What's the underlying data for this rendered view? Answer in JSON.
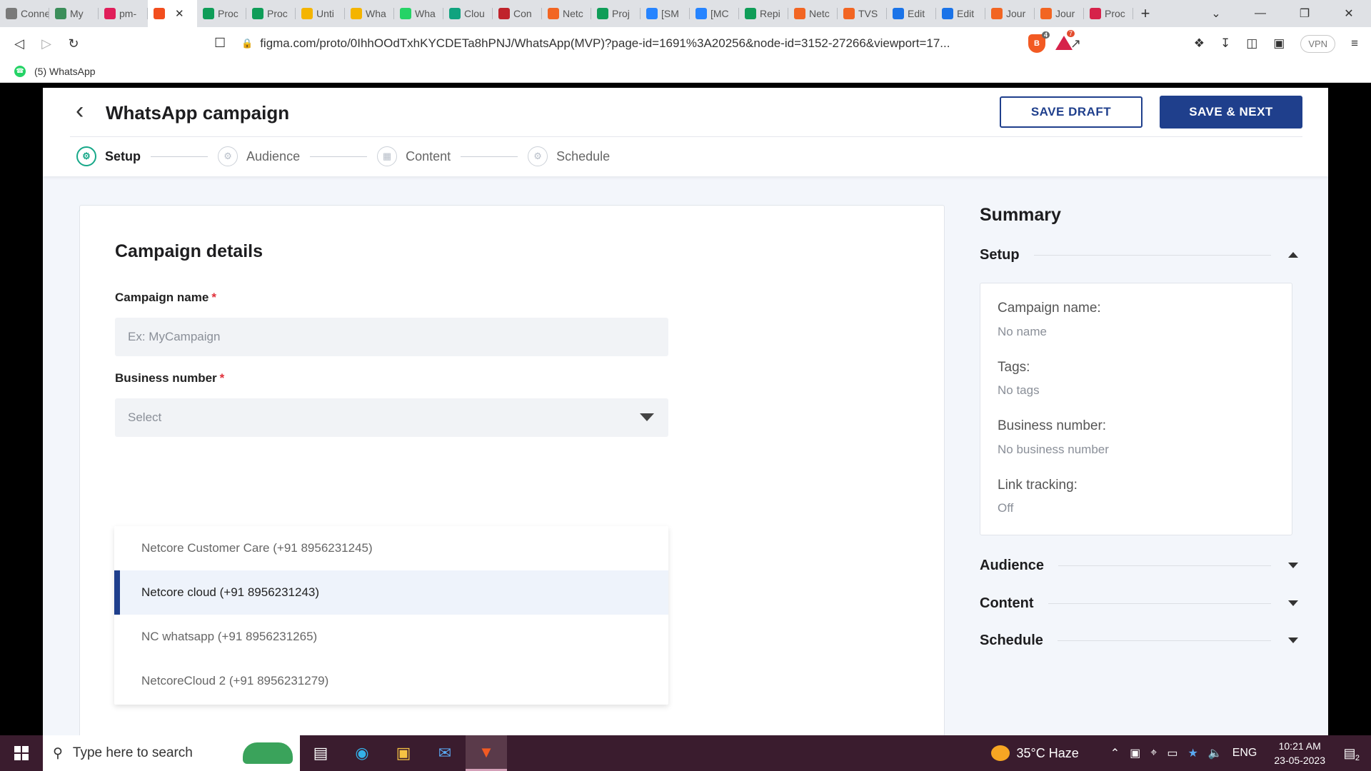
{
  "browser": {
    "tabs": [
      {
        "label": "Connect",
        "color": "#7a7a7a"
      },
      {
        "label": "My",
        "color": "#3b8e5a"
      },
      {
        "label": "pm-",
        "color": "#e01e5a"
      },
      {
        "label": "",
        "color": "#f24e1e",
        "active": true
      },
      {
        "label": "Proc",
        "color": "#0f9d58"
      },
      {
        "label": "Proc",
        "color": "#0f9d58"
      },
      {
        "label": "Unti",
        "color": "#f4b400"
      },
      {
        "label": "Wha",
        "color": "#f4b400"
      },
      {
        "label": "Wha",
        "color": "#25d366"
      },
      {
        "label": "Clou",
        "color": "#10a37f"
      },
      {
        "label": "Con",
        "color": "#c0232b"
      },
      {
        "label": "Netc",
        "color": "#f26522"
      },
      {
        "label": "Proj",
        "color": "#0f9d58"
      },
      {
        "label": "[SM",
        "color": "#2684ff"
      },
      {
        "label": "[MC",
        "color": "#2684ff"
      },
      {
        "label": "Repi",
        "color": "#0f9d58"
      },
      {
        "label": "Netc",
        "color": "#f26522"
      },
      {
        "label": "TVS",
        "color": "#f26522"
      },
      {
        "label": "Edit",
        "color": "#1a73e8"
      },
      {
        "label": "Edit",
        "color": "#1a73e8"
      },
      {
        "label": "Jour",
        "color": "#f26522"
      },
      {
        "label": "Jour",
        "color": "#f26522"
      },
      {
        "label": "Proc",
        "color": "#d6224a"
      }
    ],
    "new_tab": "+",
    "url": "figma.com/proto/0IhhOOdTxhKYCDETa8hPNJ/WhatsApp(MVP)?page-id=1691%3A20256&node-id=3152-27266&viewport=17...",
    "shield_count": "4",
    "rewards_count": "7",
    "vpn_label": "VPN",
    "bookmark": "(5) WhatsApp"
  },
  "header": {
    "title": "WhatsApp campaign",
    "save_draft": "SAVE DRAFT",
    "save_next": "SAVE & NEXT"
  },
  "steps": [
    {
      "label": "Setup",
      "active": true
    },
    {
      "label": "Audience"
    },
    {
      "label": "Content"
    },
    {
      "label": "Schedule"
    }
  ],
  "form": {
    "section_title": "Campaign details",
    "campaign_name_label": "Campaign name",
    "campaign_name_placeholder": "Ex: MyCampaign",
    "business_number_label": "Business number",
    "business_number_value": "Select",
    "required_mark": "*",
    "options": [
      "Netcore Customer Care (+91 8956231245)",
      "Netcore cloud (+91 8956231243)",
      "NC whatsapp (+91 8956231265)",
      "NetcoreCloud 2 (+91 8956231279)"
    ],
    "highlighted_option_index": 1
  },
  "summary": {
    "title": "Summary",
    "sections": [
      "Setup",
      "Audience",
      "Content",
      "Schedule"
    ],
    "fields": [
      {
        "label": "Campaign name:",
        "value": "No name"
      },
      {
        "label": "Tags:",
        "value": "No tags"
      },
      {
        "label": "Business number:",
        "value": "No business number"
      },
      {
        "label": "Link tracking:",
        "value": "Off"
      }
    ]
  },
  "taskbar": {
    "search_placeholder": "Type here to search",
    "weather": "35°C  Haze",
    "language": "ENG",
    "time": "10:21 AM",
    "date": "23-05-2023",
    "notifications": "2"
  },
  "colors": {
    "primary": "#1f3f8c",
    "step_active": "#17a889",
    "required": "#e0303a"
  }
}
